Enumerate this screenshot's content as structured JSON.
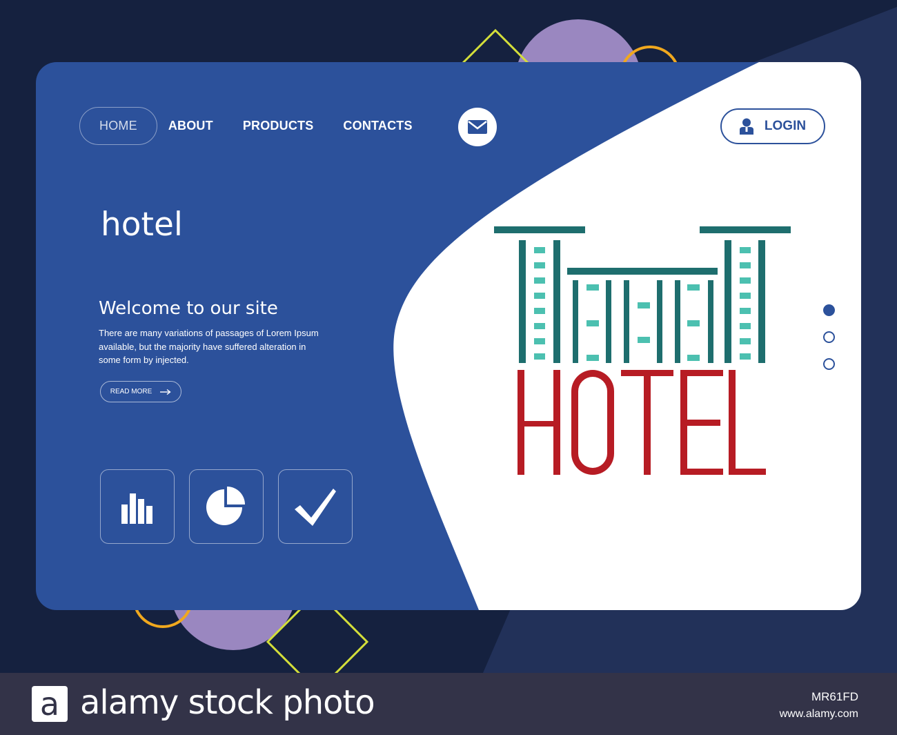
{
  "nav": {
    "items": [
      {
        "label": "HOME",
        "active": true
      },
      {
        "label": "ABOUT",
        "active": false
      },
      {
        "label": "PRODUCTS",
        "active": false
      },
      {
        "label": "CONTACTS",
        "active": false
      }
    ],
    "login_label": "LOGIN",
    "mail_icon": "envelope-icon",
    "user_icon": "user-icon"
  },
  "hero": {
    "title": "hotel",
    "welcome": "Welcome to our site",
    "description": "There are many variations of passages of Lorem Ipsum available, but the majority have suffered alteration in some form by injected.",
    "read_more": "READ MORE"
  },
  "features": [
    {
      "icon": "bar-chart-icon"
    },
    {
      "icon": "pie-chart-icon"
    },
    {
      "icon": "checkmark-icon"
    }
  ],
  "illustration": {
    "word": "HOTEL"
  },
  "pager": {
    "count": 3,
    "active_index": 0
  },
  "footer": {
    "logo_letter": "a",
    "brand": "alamy stock photo",
    "image_code": "MR61FD",
    "url": "www.alamy.com"
  },
  "colors": {
    "page_bg": "#15213f",
    "card_blue": "#2c519b",
    "teal": "#1e6e6e",
    "teal_light": "#4cc0b0",
    "red": "#b71c24",
    "lavender": "#9a87c0",
    "yellow_green": "#d4df3a",
    "orange": "#f0a81e",
    "footer_bg": "#333348"
  }
}
